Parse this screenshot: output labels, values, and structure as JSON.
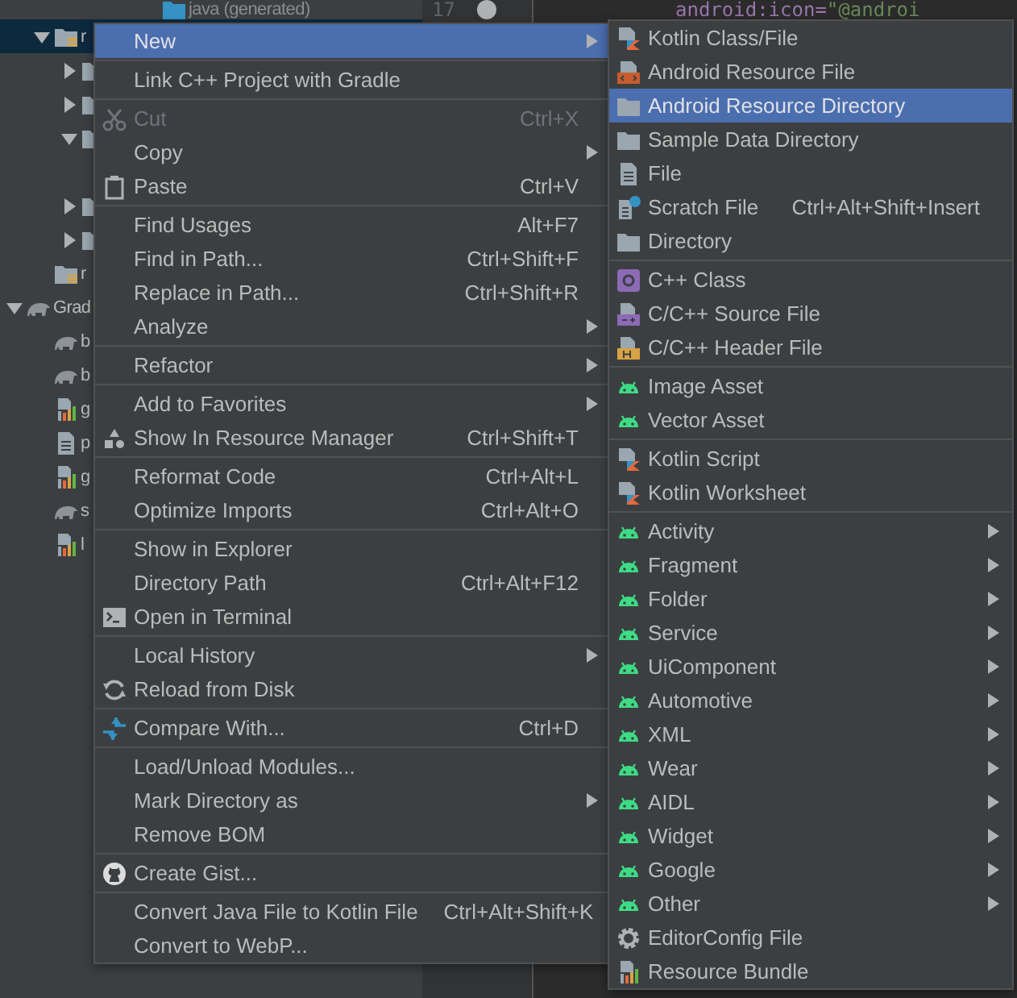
{
  "editor": {
    "line_number": "17",
    "code_attribute": "android:icon=",
    "code_value": "\"@androi"
  },
  "project_tree": [
    {
      "kind": "scrolled-parent",
      "children": [
        {
          "label": "java (generated)",
          "kind": "java-folder"
        },
        {
          "label": "r",
          "kind": "res-folder",
          "expanded": true,
          "selected": true,
          "children": [
            {
              "kind": "folder",
              "expanded": false
            },
            {
              "kind": "folder",
              "expanded": false
            },
            {
              "kind": "folder",
              "expanded": true
            },
            {
              "kind": "folder",
              "expanded": false
            },
            {
              "kind": "folder",
              "expanded": false
            }
          ]
        },
        {
          "label": "r",
          "kind": "res-folder",
          "selected": false
        }
      ]
    },
    {
      "label": "Grad",
      "kind": "gradle",
      "expanded": true,
      "selected": false,
      "children": [
        {
          "label": "b",
          "kind": "gradle"
        },
        {
          "label": "b",
          "kind": "gradle"
        },
        {
          "label": "g",
          "kind": "gradle-file"
        },
        {
          "label": "p",
          "kind": "text-file"
        },
        {
          "label": "g",
          "kind": "gradle-file"
        },
        {
          "label": "s",
          "kind": "gradle"
        },
        {
          "label": "l",
          "kind": "gradle-file"
        }
      ]
    }
  ],
  "context_menu": {
    "groups": [
      [
        {
          "label": "New",
          "submenu": true,
          "selected": true
        }
      ],
      [
        {
          "label": "Link C++ Project with Gradle"
        }
      ],
      [
        {
          "label": "Cut",
          "shortcut": "Ctrl+X",
          "kind": "scissors",
          "disabled": true
        },
        {
          "label": "Copy",
          "submenu": true
        },
        {
          "label": "Paste",
          "shortcut": "Ctrl+V",
          "kind": "clipboard"
        }
      ],
      [
        {
          "label": "Find Usages",
          "shortcut": "Alt+F7"
        },
        {
          "label": "Find in Path...",
          "shortcut": "Ctrl+Shift+F"
        },
        {
          "label": "Replace in Path...",
          "shortcut": "Ctrl+Shift+R"
        },
        {
          "label": "Analyze",
          "submenu": true
        }
      ],
      [
        {
          "label": "Refactor",
          "submenu": true
        }
      ],
      [
        {
          "label": "Add to Favorites",
          "submenu": true
        },
        {
          "label": "Show In Resource Manager",
          "shortcut": "Ctrl+Shift+T",
          "kind": "shapes"
        }
      ],
      [
        {
          "label": "Reformat Code",
          "shortcut": "Ctrl+Alt+L"
        },
        {
          "label": "Optimize Imports",
          "shortcut": "Ctrl+Alt+O"
        }
      ],
      [
        {
          "label": "Show in Explorer"
        },
        {
          "label": "Directory Path",
          "shortcut": "Ctrl+Alt+F12"
        },
        {
          "label": "Open in Terminal",
          "kind": "terminal"
        }
      ],
      [
        {
          "label": "Local History",
          "submenu": true
        },
        {
          "label": "Reload from Disk",
          "kind": "reload"
        }
      ],
      [
        {
          "label": "Compare With...",
          "shortcut": "Ctrl+D",
          "kind": "compare"
        }
      ],
      [
        {
          "label": "Load/Unload Modules..."
        },
        {
          "label": "Mark Directory as",
          "submenu": true
        },
        {
          "label": "Remove BOM"
        }
      ],
      [
        {
          "label": "Create Gist...",
          "kind": "github"
        }
      ],
      [
        {
          "label": "Convert Java File to Kotlin File",
          "shortcut": "Ctrl+Alt+Shift+K"
        },
        {
          "label": "Convert to WebP..."
        }
      ]
    ]
  },
  "new_submenu": {
    "groups": [
      [
        {
          "label": "Kotlin Class/File",
          "kind": "kotlin-file"
        },
        {
          "label": "Android Resource File",
          "kind": "resource-file"
        },
        {
          "label": "Android Resource Directory",
          "kind": "folder",
          "selected": true
        },
        {
          "label": "Sample Data Directory",
          "kind": "folder"
        },
        {
          "label": "File",
          "kind": "file"
        },
        {
          "label": "Scratch File",
          "shortcut": "Ctrl+Alt+Shift+Insert",
          "kind": "scratch"
        },
        {
          "label": "Directory",
          "kind": "folder"
        }
      ],
      [
        {
          "label": "C++ Class",
          "kind": "cpp-class"
        },
        {
          "label": "C/C++ Source File",
          "kind": "cpp-source"
        },
        {
          "label": "C/C++ Header File",
          "kind": "cpp-header"
        }
      ],
      [
        {
          "label": "Image Asset",
          "kind": "android"
        },
        {
          "label": "Vector Asset",
          "kind": "android"
        }
      ],
      [
        {
          "label": "Kotlin Script",
          "kind": "kotlin-file"
        },
        {
          "label": "Kotlin Worksheet",
          "kind": "kotlin-file"
        }
      ],
      [
        {
          "label": "Activity",
          "kind": "android",
          "submenu": true
        },
        {
          "label": "Fragment",
          "kind": "android",
          "submenu": true
        },
        {
          "label": "Folder",
          "kind": "android",
          "submenu": true
        },
        {
          "label": "Service",
          "kind": "android",
          "submenu": true
        },
        {
          "label": "UiComponent",
          "kind": "android",
          "submenu": true
        },
        {
          "label": "Automotive",
          "kind": "android",
          "submenu": true
        },
        {
          "label": "XML",
          "kind": "android",
          "submenu": true
        },
        {
          "label": "Wear",
          "kind": "android",
          "submenu": true
        },
        {
          "label": "AIDL",
          "kind": "android",
          "submenu": true
        },
        {
          "label": "Widget",
          "kind": "android",
          "submenu": true
        },
        {
          "label": "Google",
          "kind": "android",
          "submenu": true
        },
        {
          "label": "Other",
          "kind": "android",
          "submenu": true
        },
        {
          "label": "EditorConfig File",
          "kind": "gear"
        },
        {
          "label": "Resource Bundle",
          "kind": "gradle-file"
        }
      ]
    ]
  }
}
